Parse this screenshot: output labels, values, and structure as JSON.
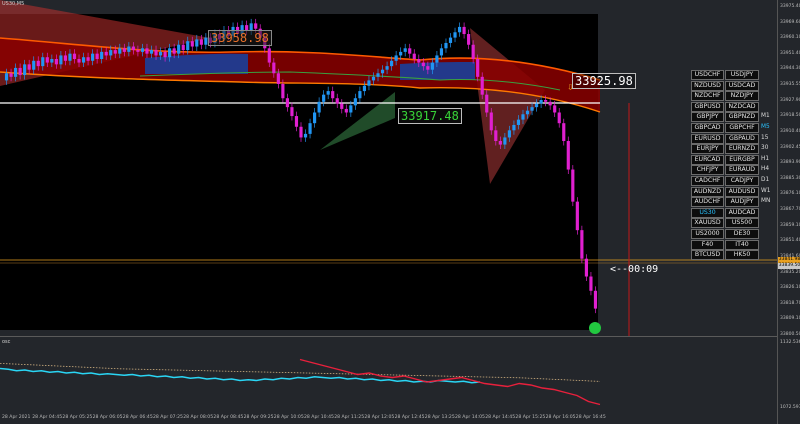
{
  "chart": {
    "symbol": "US30,M5",
    "subwindow_label": "osc",
    "labels": {
      "high": "33958.98",
      "low": "33917.48",
      "right": "33925.98",
      "countdown": "<--00:09"
    },
    "colors": {
      "background": "#000000",
      "frame": "#23262b",
      "candle_up": "#2196f3",
      "candle_down": "#e020d0",
      "band_fill": "#8b0000",
      "band_upper": "#ff5a00",
      "band_lower": "#ff7a00",
      "inner_line": "#3aa040",
      "horizontal_line": "#ffffff",
      "price_line": "#e8a020",
      "vertical_line": "#c01818",
      "osc_cyan": "#2ad6f5",
      "osc_red": "#e8203c",
      "osc_dotted": "#d0b080",
      "highlight": "#29c3ff"
    }
  },
  "price_scale": {
    "ticks": [
      "33975.40",
      "33969.60",
      "33960.10",
      "33951.40",
      "33944.30",
      "33935.55",
      "33927.90",
      "33918.50",
      "33910.40",
      "33902.45",
      "33893.90",
      "33885.30",
      "33876.10",
      "33867.70",
      "33859.10",
      "33851.40",
      "33841.60",
      "33835.20",
      "33826.10",
      "33818.70",
      "33809.10",
      "33800.50"
    ],
    "sub_ticks": [
      "1132.5364",
      "1072.5978"
    ],
    "current_price_1": "33841.98",
    "current_price_2": "33839.50"
  },
  "time_scale": {
    "ticks": [
      "28 Apr 2021",
      "28 Apr 04:45",
      "28 Apr 05:25",
      "28 Apr 06:05",
      "28 Apr 06:45",
      "28 Apr 07:25",
      "28 Apr 08:05",
      "28 Apr 08:45",
      "28 Apr 09:25",
      "28 Apr 10:05",
      "28 Apr 10:45",
      "28 Apr 11:25",
      "28 Apr 12:05",
      "28 Apr 12:45",
      "28 Apr 13:25",
      "28 Apr 14:05",
      "28 Apr 14:45",
      "28 Apr 15:25",
      "28 Apr 16:05",
      "28 Apr 16:45"
    ]
  },
  "symbols": [
    [
      "USDCHF",
      "USDJPY",
      ""
    ],
    [
      "NZDUSD",
      "USDCAD",
      ""
    ],
    [
      "NZDCHF",
      "NZDJPY",
      ""
    ],
    [
      "GBPUSD",
      "NZDCAD",
      ""
    ],
    [
      "GBPJPY",
      "GBPNZD",
      "M1"
    ],
    [
      "GBPCAD",
      "GBPCHF",
      "M5"
    ],
    [
      "EURUSD",
      "GBPAUD",
      "15"
    ],
    [
      "EURJPY",
      "EURNZD",
      "30"
    ],
    [
      "EURCAD",
      "EURGBP",
      "H1"
    ],
    [
      "CHFJPY",
      "EURAUD",
      "H4"
    ],
    [
      "CADCHF",
      "CADJPY",
      "D1"
    ],
    [
      "AUDNZD",
      "AUDUSD",
      "W1"
    ],
    [
      "AUDCHF",
      "AUDJPY",
      "MN"
    ],
    [
      "US30",
      "AUDCAD",
      ""
    ],
    [
      "XAUUSD",
      "US500",
      ""
    ],
    [
      "US2000",
      "DE30",
      ""
    ],
    [
      "F40",
      "IT40",
      ""
    ],
    [
      "BTCUSD",
      "HK50",
      ""
    ]
  ],
  "selected_symbol": "US30",
  "selected_timeframe": "M5",
  "candles": [
    33940,
    33944,
    33942,
    33947,
    33943,
    33949,
    33946,
    33951,
    33948,
    33953,
    33950,
    33952,
    33949,
    33954,
    33951,
    33955,
    33952,
    33950,
    33953,
    33951,
    33955,
    33952,
    33956,
    33954,
    33957,
    33955,
    33958,
    33956,
    33959,
    33957,
    33956,
    33958,
    33955,
    33957,
    33954,
    33956,
    33953,
    33958,
    33955,
    33960,
    33957,
    33962,
    33959,
    33963,
    33960,
    33964,
    33961,
    33966,
    33963,
    33968,
    33965,
    33970,
    33966,
    33971,
    33968,
    33972,
    33969,
    33964,
    33958,
    33950,
    33944,
    33938,
    33930,
    33925,
    33920,
    33914,
    33908,
    33910,
    33916,
    33922,
    33928,
    33932,
    33934,
    33930,
    33927,
    33924,
    33922,
    33926,
    33930,
    33934,
    33937,
    33940,
    33942,
    33944,
    33946,
    33948,
    33951,
    33954,
    33956,
    33958,
    33955,
    33952,
    33950,
    33948,
    33946,
    33950,
    33954,
    33958,
    33961,
    33964,
    33967,
    33970,
    33966,
    33960,
    33952,
    33942,
    33932,
    33922,
    33912,
    33906,
    33904,
    33908,
    33912,
    33915,
    33918,
    33921,
    33923,
    33925,
    33927,
    33929,
    33928,
    33926,
    33922,
    33916,
    33906,
    33890,
    33872,
    33856,
    33840,
    33830,
    33822,
    33812
  ],
  "oscillator": {
    "cyan": [
      58,
      57,
      55,
      56,
      54,
      55,
      53,
      54,
      52,
      53,
      51,
      52,
      50,
      51,
      50,
      49,
      50,
      48,
      49,
      47,
      48,
      46,
      47,
      45,
      46,
      44,
      45,
      43,
      44,
      42,
      43,
      42,
      44,
      43,
      45,
      44,
      46,
      45,
      47,
      46,
      45,
      46,
      44,
      45,
      43,
      44,
      42,
      43,
      41,
      42,
      40,
      41,
      40,
      42,
      41,
      40,
      41,
      39,
      40
    ],
    "red": [
      40,
      44,
      48,
      52,
      56,
      60,
      58,
      62,
      64,
      62,
      66,
      70,
      68,
      66,
      64,
      68,
      72,
      74,
      76,
      72,
      74,
      78,
      80,
      84,
      88,
      96,
      100
    ],
    "dotted": [
      42,
      44,
      46,
      48,
      50,
      52,
      54,
      55,
      56,
      57,
      58,
      59,
      60,
      61,
      62,
      63,
      64,
      65,
      66,
      67,
      68,
      69,
      70,
      71,
      72,
      73,
      74,
      76,
      78,
      80,
      82
    ]
  }
}
